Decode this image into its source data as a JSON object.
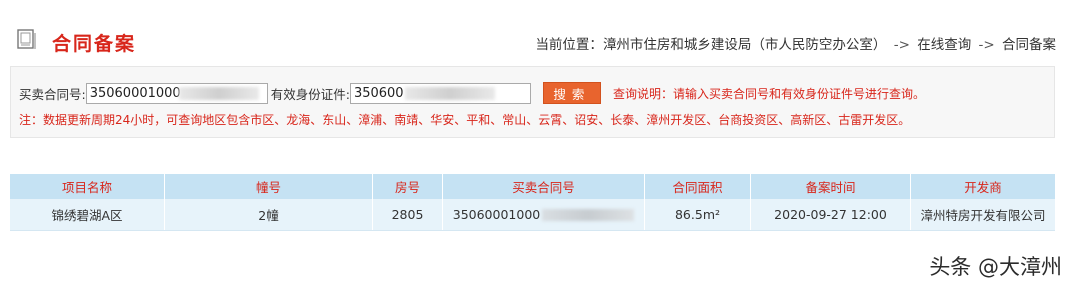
{
  "header": {
    "title": "合同备案",
    "breadcrumb": {
      "prefix": "当前位置：",
      "items": [
        "漳州市住房和城乡建设局（市人民防空办公室）",
        "在线查询",
        "合同备案"
      ],
      "separator": "->"
    }
  },
  "search": {
    "contract_label": "买卖合同号:",
    "contract_value": "35060001000",
    "id_label": "有效身份证件:",
    "id_value": "350600",
    "button_label": "搜索",
    "hint": "查询说明：请输入买卖合同号和有效身份证件号进行查询。",
    "notice": "注：数据更新周期24小时，可查询地区包含市区、龙海、东山、漳浦、南靖、华安、平和、常山、云霄、诏安、长泰、漳州开发区、台商投资区、高新区、古雷开发区。"
  },
  "table": {
    "columns": [
      "项目名称",
      "幢号",
      "房号",
      "买卖合同号",
      "合同面积",
      "备案时间",
      "开发商"
    ],
    "rows": [
      {
        "project": "锦绣碧湖A区",
        "building": "2幢",
        "room": "2805",
        "contract": "35060001000",
        "area": "86.5m²",
        "record_time": "2020-09-27 12:00",
        "developer": "漳州特房开发有限公司"
      }
    ]
  },
  "watermark": "头条 @大漳州",
  "colors": {
    "accent_red": "#d8261b",
    "button_orange": "#e8642e",
    "table_header": "#c5e2f3",
    "table_row": "#e7f3fa"
  }
}
